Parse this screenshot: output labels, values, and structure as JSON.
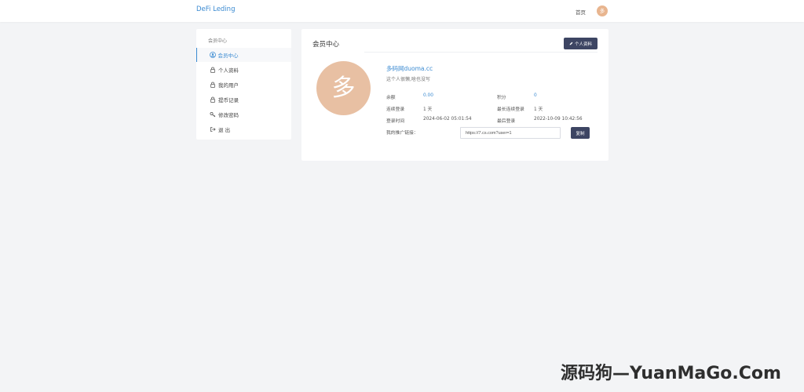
{
  "header": {
    "brand": "DeFi Leding",
    "home_label": "首页",
    "avatar_char": "多"
  },
  "sidebar": {
    "title": "会员中心",
    "items": [
      {
        "label": "会员中心",
        "icon": "user-circle-icon",
        "active": true
      },
      {
        "label": "个人资料",
        "icon": "lock-icon",
        "active": false
      },
      {
        "label": "我的用户",
        "icon": "lock-icon",
        "active": false
      },
      {
        "label": "提币记录",
        "icon": "lock-icon",
        "active": false
      },
      {
        "label": "修改密码",
        "icon": "key-icon",
        "active": false
      },
      {
        "label": "退 出",
        "icon": "sign-out-icon",
        "active": false
      }
    ]
  },
  "panel": {
    "title": "会员中心",
    "profile_button": "个人资料",
    "avatar_char": "多",
    "username": "多码网duoma.cc",
    "signature": "这个人很懒,啥也没写",
    "stats": {
      "balance_label": "余额",
      "balance_value": "0.00",
      "points_label": "积分",
      "points_value": "0",
      "consecutive_label": "连续登录",
      "consecutive_value": "1 天",
      "max_consecutive_label": "最长连续登录",
      "max_consecutive_value": "1 天",
      "login_time_label": "登录时间",
      "login_time_value": "2024-06-02 05:01:54",
      "last_login_label": "最后登录",
      "last_login_value": "2022-10-09 10:42:56"
    },
    "promo_label": "我的推广链接：",
    "promo_link": "https://7.cs.com?user=1",
    "copy_button": "复制"
  },
  "watermark": "源码狗—YuanMaGo.Com",
  "colors": {
    "accent": "#3a8ad1",
    "button_dark": "#3d4563",
    "avatar": "#e8c0a3",
    "background": "#f3f4f6"
  }
}
